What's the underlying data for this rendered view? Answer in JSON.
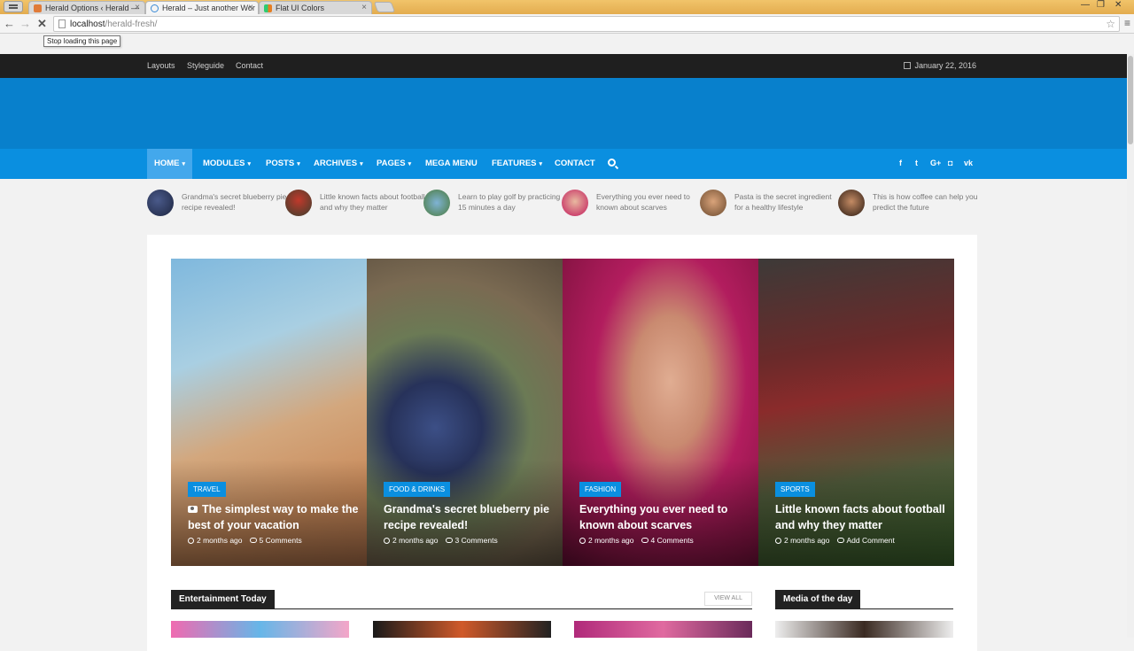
{
  "browser": {
    "tabs": [
      {
        "title": "Herald Options ‹ Herald —",
        "active": false
      },
      {
        "title": "Herald – Just another Wor",
        "active": true
      },
      {
        "title": "Flat UI Colors",
        "active": false
      }
    ],
    "url_host": "localhost",
    "url_path": "/herald-fresh/",
    "tooltip": "Stop loading this page",
    "icons": {
      "back": "arrow-left-icon",
      "forward": "arrow-right-icon",
      "stop": "close-icon",
      "bookmark": "star-icon",
      "menu": "hamburger-icon"
    }
  },
  "topbar": {
    "links": [
      "Layouts",
      "Styleguide",
      "Contact"
    ],
    "date": "January 22, 2016"
  },
  "colors": {
    "header": "#0880cc",
    "nav": "#0a8fe0",
    "nav_active": "#43a8ec",
    "topbar": "#1f1f1f",
    "category_badge": "#0a8fe0"
  },
  "nav": {
    "items": [
      {
        "label": "HOME",
        "caret": "▾"
      },
      {
        "label": "MODULES",
        "caret": "▾"
      },
      {
        "label": "POSTS",
        "caret": "▾"
      },
      {
        "label": "ARCHIVES",
        "caret": "▾"
      },
      {
        "label": "PAGES",
        "caret": "▾"
      },
      {
        "label": "MEGA MENU",
        "caret": ""
      },
      {
        "label": "FEATURES",
        "caret": "▾"
      },
      {
        "label": "CONTACT",
        "caret": ""
      }
    ],
    "social": [
      "f",
      "t",
      "G+",
      "◘",
      "vk"
    ]
  },
  "trending": [
    "Grandma's secret blueberry pie recipe revealed!",
    "Little known facts about football and why they matter",
    "Learn to play golf by practicing 15 minutes a day",
    "Everything you ever need to known about scarves",
    "Pasta is the secret ingredient for a healthy lifestyle",
    "This is how coffee can help you predict the future"
  ],
  "features": [
    {
      "category": "TRAVEL",
      "title": "The simplest way to make the best of your vacation",
      "time": "2 months ago",
      "comments": "5 Comments"
    },
    {
      "category": "FOOD & DRINKS",
      "title": "Grandma's secret blueberry pie recipe revealed!",
      "time": "2 months ago",
      "comments": "3 Comments"
    },
    {
      "category": "FASHION",
      "title": "Everything you ever need to known about scarves",
      "time": "2 months ago",
      "comments": "4 Comments"
    },
    {
      "category": "SPORTS",
      "title": "Little known facts about football and why they matter",
      "time": "2 months ago",
      "comments": "Add Comment"
    }
  ],
  "sections": {
    "entertainment": "Entertainment Today",
    "view_all": "VIEW ALL",
    "media": "Media of the day"
  }
}
